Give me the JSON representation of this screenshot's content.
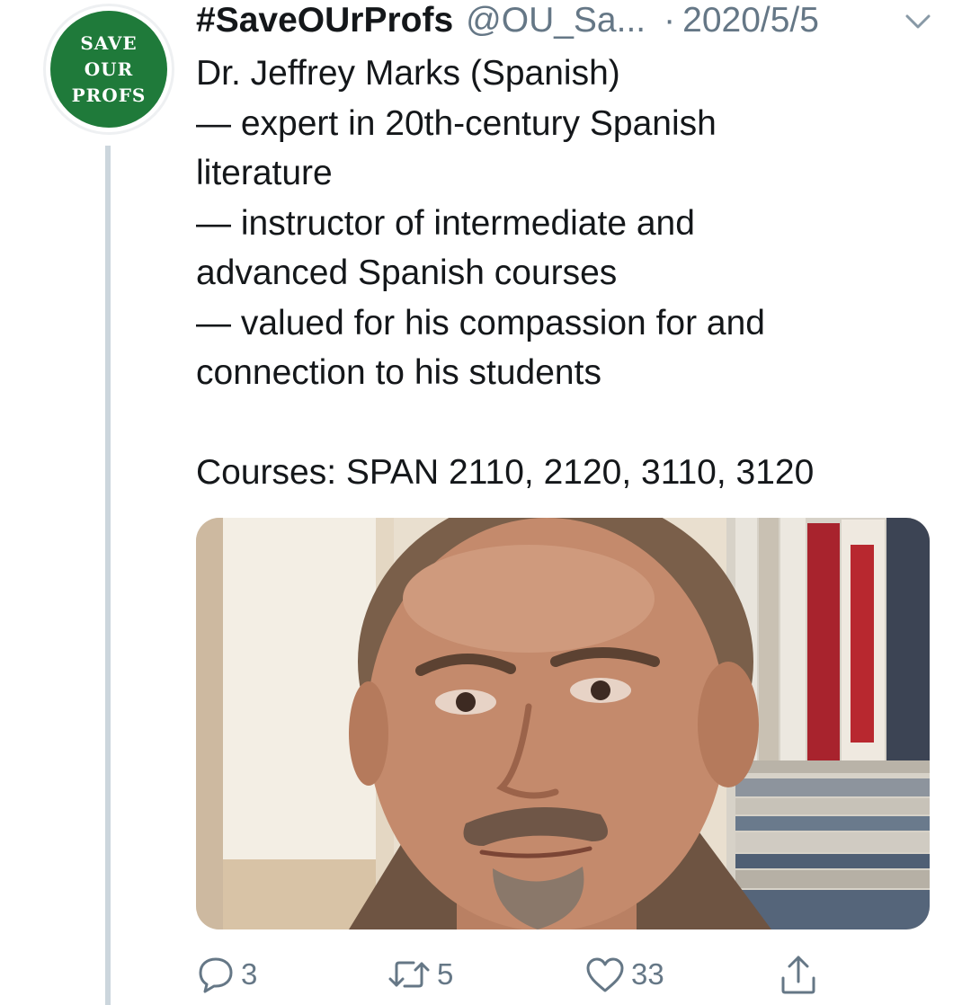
{
  "tweet": {
    "avatar": {
      "text_lines": [
        "SAVE",
        "OUR",
        "PROFS"
      ],
      "color": "#1f7a3a"
    },
    "display_name": "#SaveOUrProfs",
    "handle": "@OU_Sa...",
    "separator": "·",
    "date": "2020/5/5",
    "menu_icon": "chevron-down-icon",
    "lines": [
      "Dr. Jeffrey Marks (Spanish)",
      "— expert in 20th-century Spanish",
      "literature",
      "— instructor of intermediate and",
      "advanced Spanish courses",
      "— valued for his compassion for and",
      "connection to his students"
    ],
    "courses": "Courses: SPAN 2110, 2120, 3110, 3120",
    "actions": {
      "reply": {
        "icon": "reply-icon",
        "count": "3"
      },
      "retweet": {
        "icon": "retweet-icon",
        "count": "5"
      },
      "like": {
        "icon": "heart-icon",
        "count": "33"
      },
      "share": {
        "icon": "share-icon"
      }
    }
  },
  "colors": {
    "text": "#14171a",
    "secondary": "#657786",
    "thread_line": "#ccd6dd"
  }
}
